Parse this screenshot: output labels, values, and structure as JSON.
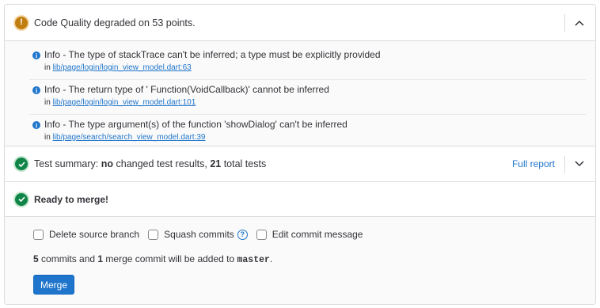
{
  "code_quality": {
    "header": "Code Quality degraded on 53 points.",
    "issues": [
      {
        "text": "Info - The type of stackTrace can't be inferred; a type must be explicitly provided",
        "in_label": "in",
        "path": "lib/page/login/login_view_model.dart:63"
      },
      {
        "text": "Info - The return type of ' Function(VoidCallback)' cannot be inferred",
        "in_label": "in",
        "path": "lib/page/login/login_view_model.dart:101"
      },
      {
        "text": "Info - The type argument(s) of the function 'showDialog' can't be inferred",
        "in_label": "in",
        "path": "lib/page/search/search_view_model.dart:39"
      }
    ]
  },
  "test_summary": {
    "prefix": "Test summary: ",
    "changed": "no",
    "middle": " changed test results, ",
    "total": "21",
    "suffix": " total tests",
    "full_report": "Full report"
  },
  "merge": {
    "ready_text": "Ready to merge!",
    "options": {
      "delete_branch": "Delete source branch",
      "squash": "Squash commits",
      "edit_message": "Edit commit message"
    },
    "commit_info": {
      "commits": "5",
      "commits_text": " commits and ",
      "merge_commits": "1",
      "merge_text": " merge commit will be added to ",
      "branch": "master",
      "end": "."
    },
    "button": "Merge"
  },
  "colors": {
    "warning": "#c17d10",
    "success": "#108548",
    "link": "#1f75cb",
    "button": "#1f75cb"
  },
  "icons": {
    "code_quality_status": "warning-icon",
    "issue": "info-icon",
    "test_status": "success-icon",
    "ready_status": "success-icon",
    "collapse": "chevron-up-icon",
    "expand": "chevron-down-icon",
    "help": "question-circle-icon"
  }
}
